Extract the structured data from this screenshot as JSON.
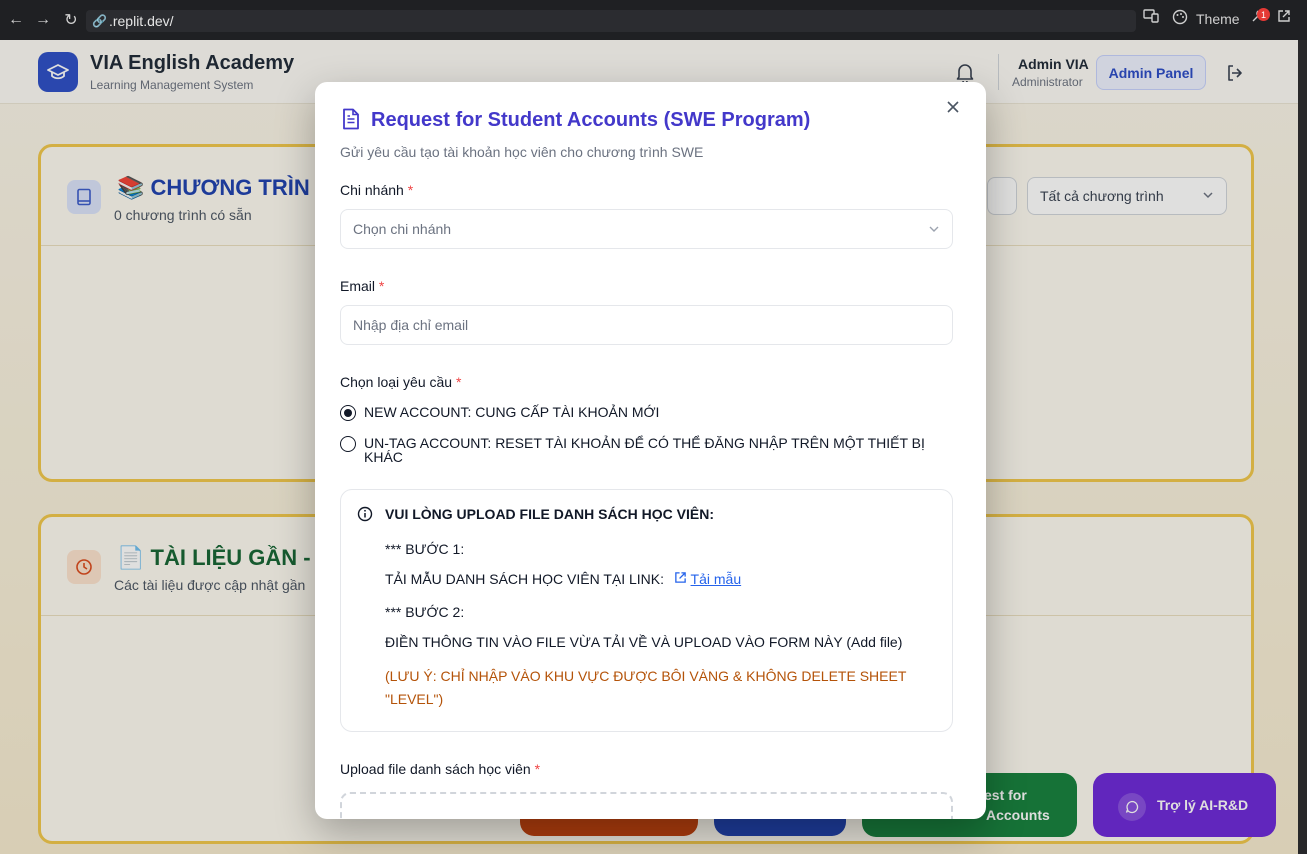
{
  "browser": {
    "url": ".replit.dev/",
    "theme_label": "Theme",
    "notif_count": "1"
  },
  "app": {
    "title": "VIA English Academy",
    "subtitle": "Learning Management System",
    "user_name": "Admin VIA",
    "user_role": "Administrator",
    "admin_panel_label": "Admin Panel"
  },
  "programs": {
    "title": "CHƯƠNG TRÌN",
    "subtitle": "0 chương trình có sẵn",
    "filter_label": "Tất cả chương trình"
  },
  "documents": {
    "title": "TÀI LIỆU GẦN -",
    "subtitle": "Các tài liệu được cập nhật gần"
  },
  "fab": {
    "request_label_line1": "est for",
    "request_label_line2": "Accounts",
    "assistant_label": "Trợ lý AI-R&D"
  },
  "modal": {
    "title": "Request for Student Accounts (SWE Program)",
    "description": "Gửi yêu cầu tạo tài khoản học viên cho chương trình SWE",
    "branch": {
      "label": "Chi nhánh",
      "required": "*",
      "placeholder": "Chọn chi nhánh"
    },
    "email": {
      "label": "Email",
      "required": "*",
      "placeholder": "Nhập địa chỉ email"
    },
    "request_type": {
      "label": "Chọn loại yêu cầu",
      "required": "*",
      "options": [
        {
          "label": "NEW ACCOUNT: CUNG CẤP TÀI KHOẢN MỚI",
          "selected": true
        },
        {
          "label": "UN-TAG ACCOUNT: RESET TÀI KHOẢN ĐỂ CÓ THỂ ĐĂNG NHẬP TRÊN MỘT THIẾT BỊ KHÁC",
          "selected": false
        }
      ]
    },
    "info": {
      "heading": "VUI LÒNG UPLOAD FILE DANH SÁCH HỌC VIÊN:",
      "step1_title": "*** BƯỚC 1:",
      "step1_text": "TẢI MẪU DANH SÁCH HỌC VIÊN TẠI LINK:",
      "template_link": "Tải mẫu",
      "step2_title": "*** BƯỚC 2:",
      "step2_text": "ĐIỀN THÔNG TIN VÀO FILE VỪA TẢI VỀ VÀ UPLOAD VÀO FORM NÀY (Add file)",
      "warning": "(LƯU Ý: CHỈ NHẬP VÀO KHU VỰC ĐƯỢC BÔI VÀNG & KHÔNG DELETE SHEET \"LEVEL\")"
    },
    "upload": {
      "label": "Upload file danh sách học viên",
      "required": "*"
    }
  }
}
